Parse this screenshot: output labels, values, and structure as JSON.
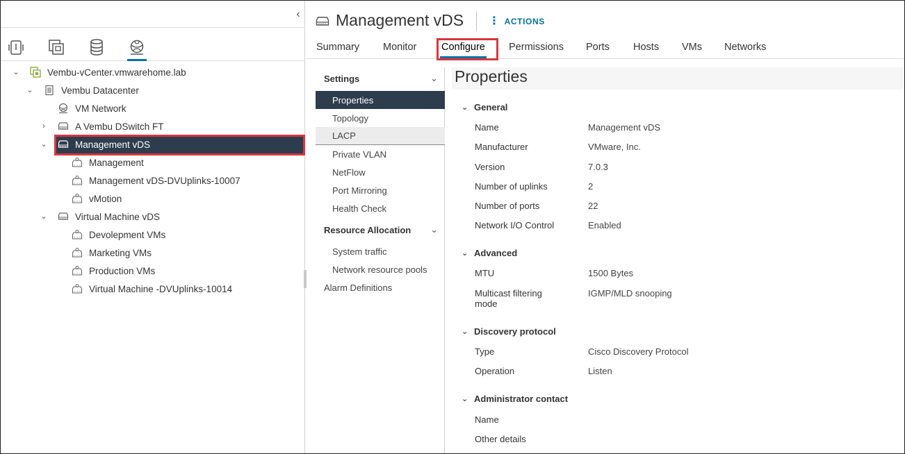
{
  "navigator": {
    "collapse_icon": "chevron-left-icon",
    "tabs": [
      {
        "name": "hosts-and-clusters-icon"
      },
      {
        "name": "vms-and-templates-icon"
      },
      {
        "name": "storage-icon"
      },
      {
        "name": "networking-icon",
        "active": true
      }
    ],
    "tree": [
      {
        "label": "Vembu-vCenter.vmwarehome.lab",
        "icon": "vcenter-icon",
        "expanded": true
      },
      {
        "label": "Vembu Datacenter",
        "icon": "datacenter-icon",
        "expanded": true
      },
      {
        "label": "VM Network",
        "icon": "network-icon"
      },
      {
        "label": "A Vembu DSwitch FT",
        "icon": "distributed-switch-icon",
        "expanded": false
      },
      {
        "label": "Management vDS",
        "icon": "distributed-switch-icon",
        "expanded": true,
        "selected": true
      },
      {
        "label": "Management",
        "icon": "port-group-icon"
      },
      {
        "label": "Management vDS-DVUplinks-10007",
        "icon": "port-group-icon"
      },
      {
        "label": "vMotion",
        "icon": "port-group-icon"
      },
      {
        "label": "Virtual Machine vDS",
        "icon": "distributed-switch-icon",
        "expanded": true
      },
      {
        "label": "Devolepment VMs",
        "icon": "port-group-icon"
      },
      {
        "label": "Marketing VMs",
        "icon": "port-group-icon"
      },
      {
        "label": "Production VMs",
        "icon": "port-group-icon"
      },
      {
        "label": "Virtual Machine -DVUplinks-10014",
        "icon": "port-group-icon"
      }
    ]
  },
  "header": {
    "title": "Management vDS",
    "actions_label": "ACTIONS"
  },
  "tabs": [
    "Summary",
    "Monitor",
    "Configure",
    "Permissions",
    "Ports",
    "Hosts",
    "VMs",
    "Networks"
  ],
  "active_tab": "Configure",
  "configure_menu": {
    "settings_label": "Settings",
    "settings_items": [
      "Properties",
      "Topology",
      "LACP",
      "Private VLAN",
      "NetFlow",
      "Port Mirroring",
      "Health Check"
    ],
    "active_item": "Properties",
    "hover_item": "LACP",
    "resource_label": "Resource Allocation",
    "resource_items": [
      "System traffic",
      "Network resource pools"
    ],
    "alarm_label": "Alarm Definitions"
  },
  "properties": {
    "title": "Properties",
    "sections": [
      {
        "title": "General",
        "rows": [
          {
            "label": "Name",
            "value": "Management vDS"
          },
          {
            "label": "Manufacturer",
            "value": "VMware, Inc."
          },
          {
            "label": "Version",
            "value": "7.0.3"
          },
          {
            "label": "Number of uplinks",
            "value": "2"
          },
          {
            "label": "Number of ports",
            "value": "22"
          },
          {
            "label": "Network I/O Control",
            "value": "Enabled"
          }
        ]
      },
      {
        "title": "Advanced",
        "rows": [
          {
            "label": "MTU",
            "value": "1500 Bytes"
          },
          {
            "label": "Multicast filtering mode",
            "value": "IGMP/MLD snooping"
          }
        ]
      },
      {
        "title": "Discovery protocol",
        "rows": [
          {
            "label": "Type",
            "value": "Cisco Discovery Protocol"
          },
          {
            "label": "Operation",
            "value": "Listen"
          }
        ]
      },
      {
        "title": "Administrator contact",
        "rows": [
          {
            "label": "Name",
            "value": ""
          },
          {
            "label": "Other details",
            "value": ""
          }
        ]
      }
    ]
  },
  "colors": {
    "accent": "#0072a3",
    "selection": "#2e3d4d",
    "highlight_box": "#d9363e"
  }
}
